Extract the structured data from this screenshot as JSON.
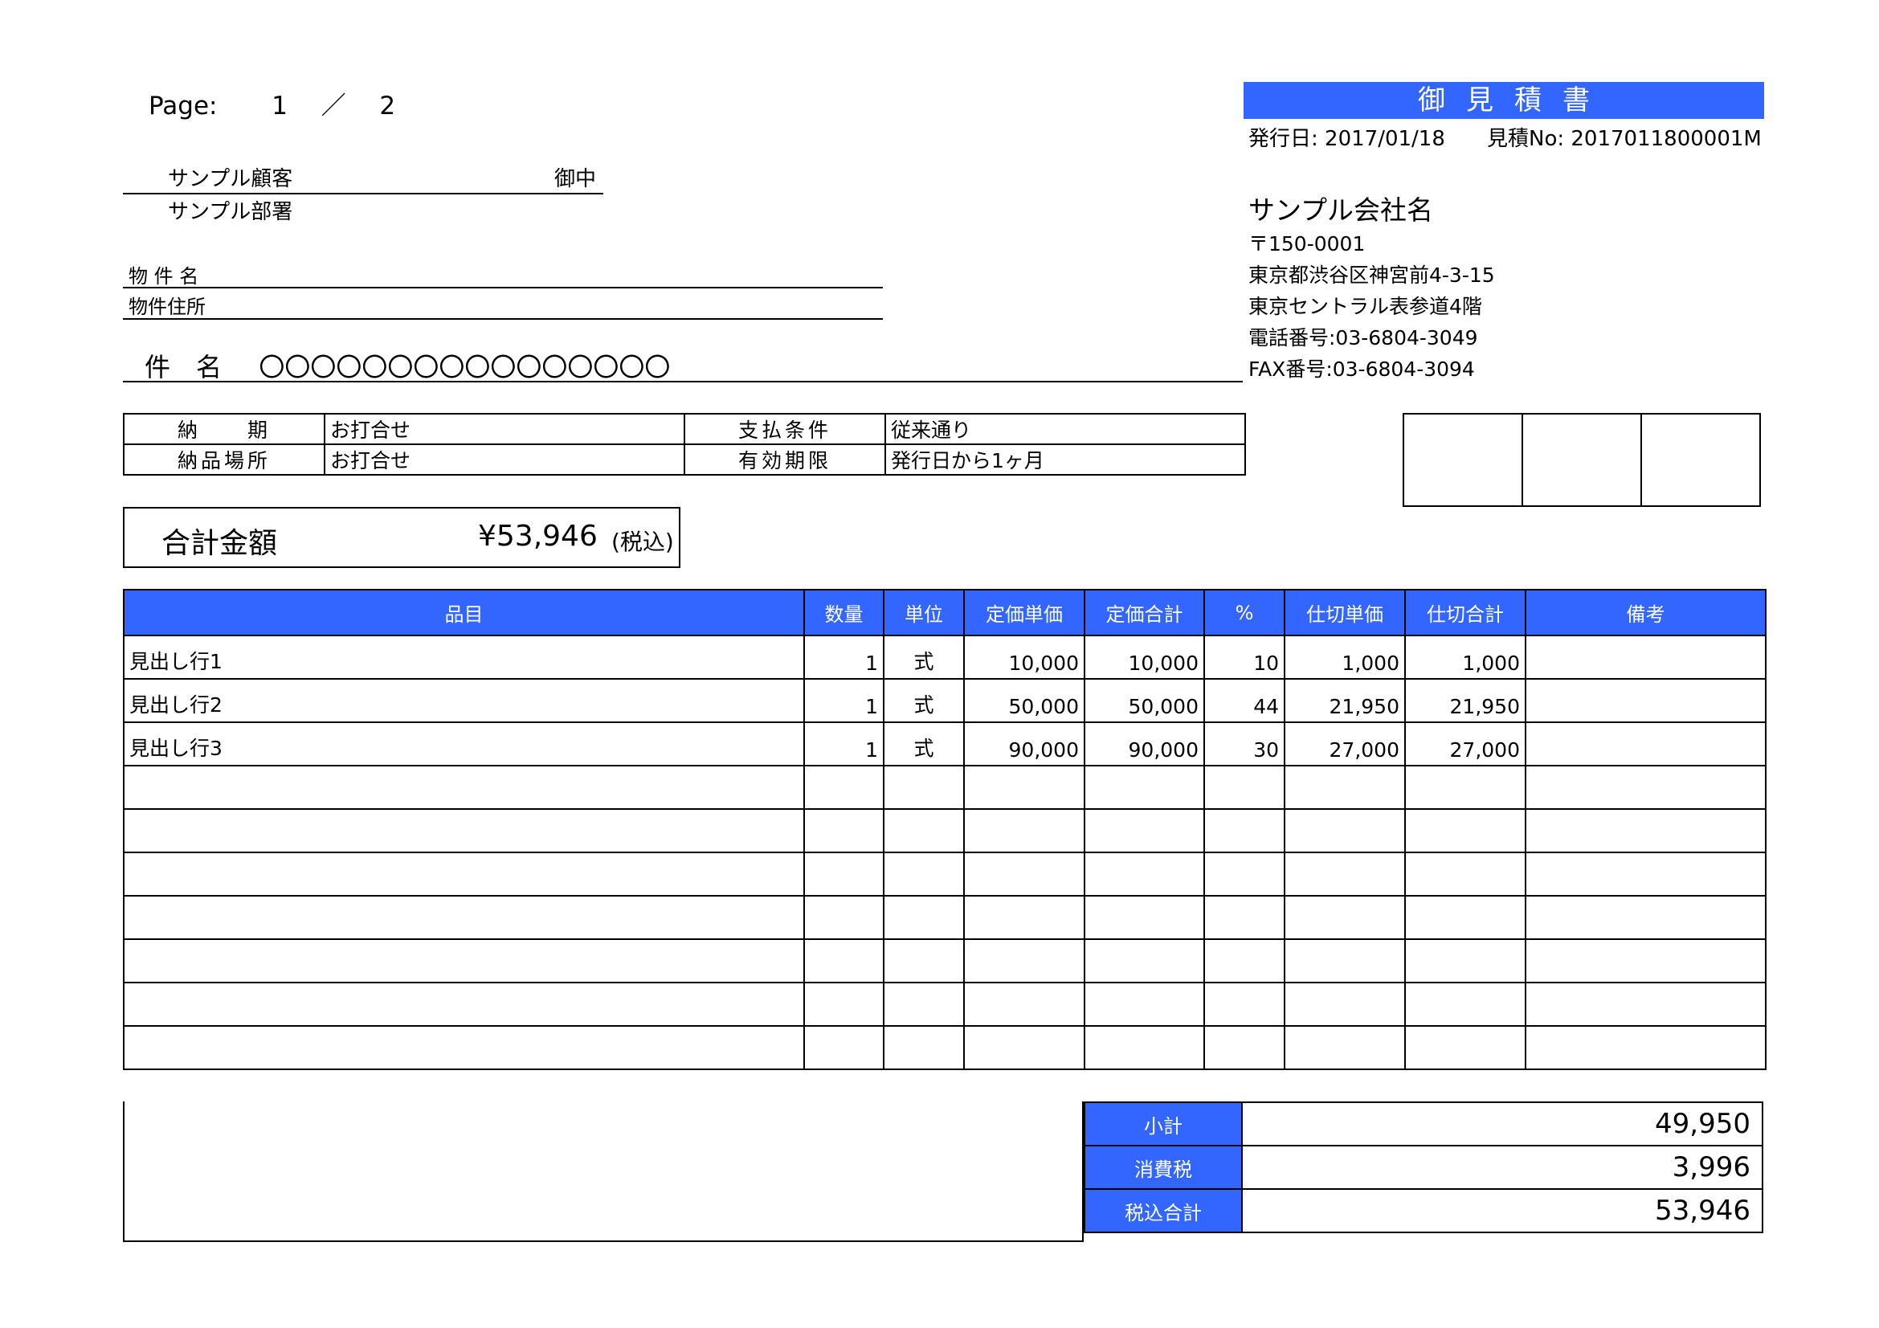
{
  "page": {
    "label": "Page:",
    "current": "1",
    "separator": "／",
    "total": "2"
  },
  "document": {
    "title": "御見積書",
    "issue_label": "発行日:",
    "issue_date": "2017/01/18",
    "estimate_label": "見積No:",
    "estimate_no": "2017011800001M"
  },
  "customer": {
    "name": "サンプル顧客",
    "honorific": "御中",
    "department": "サンプル部署"
  },
  "property": {
    "name_label": "物 件 名",
    "address_label": "物件住所"
  },
  "subject": {
    "label": "件　名",
    "value": "〇〇〇〇〇〇〇〇〇〇〇〇〇〇〇〇"
  },
  "company": {
    "name": "サンプル会社名",
    "postal": "〒150-0001",
    "address1": "東京都渋谷区神宮前4-3-15",
    "address2": "東京セントラル表参道4階",
    "phone": "電話番号:03-6804-3049",
    "fax": "FAX番号:03-6804-3094"
  },
  "terms": {
    "delivery_label": "納　　期",
    "delivery_value": "お打合せ",
    "payment_label": "支払条件",
    "payment_value": "従来通り",
    "place_label": "納品場所",
    "place_value": "お打合せ",
    "validity_label": "有効期限",
    "validity_value": "発行日から1ヶ月"
  },
  "total": {
    "label": "合計金額",
    "amount": "¥53,946",
    "note": "(税込)"
  },
  "items_header": [
    "品目",
    "数量",
    "単位",
    "定価単価",
    "定価合計",
    "%",
    "仕切単価",
    "仕切合計",
    "備考"
  ],
  "items": [
    {
      "name": "見出し行1",
      "qty": "1",
      "unit": "式",
      "list_price": "10,000",
      "list_total": "10,000",
      "pct": "10",
      "net_price": "1,000",
      "net_total": "1,000",
      "note": ""
    },
    {
      "name": "見出し行2",
      "qty": "1",
      "unit": "式",
      "list_price": "50,000",
      "list_total": "50,000",
      "pct": "44",
      "net_price": "21,950",
      "net_total": "21,950",
      "note": ""
    },
    {
      "name": "見出し行3",
      "qty": "1",
      "unit": "式",
      "list_price": "90,000",
      "list_total": "90,000",
      "pct": "30",
      "net_price": "27,000",
      "net_total": "27,000",
      "note": ""
    }
  ],
  "summary": {
    "subtotal_label": "小計",
    "subtotal": "49,950",
    "tax_label": "消費税",
    "tax": "3,996",
    "total_label": "税込合計",
    "total": "53,946"
  },
  "colors": {
    "accent": "#3366ff",
    "line": "#000000",
    "header_text": "#ffffff"
  }
}
